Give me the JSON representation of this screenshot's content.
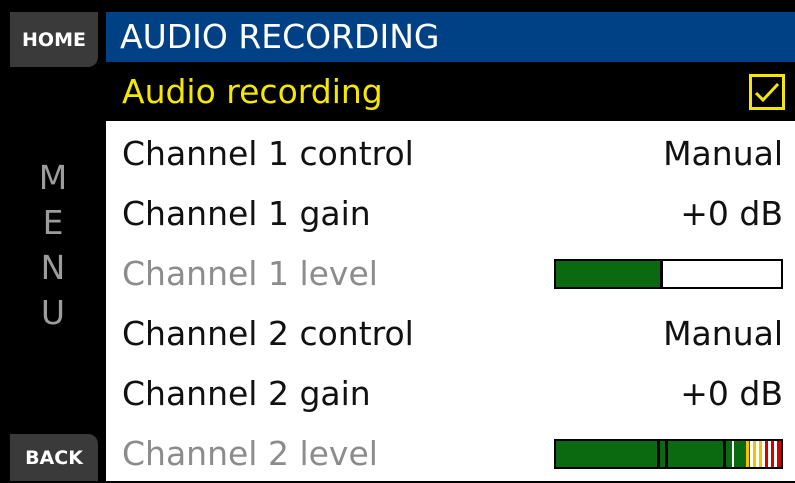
{
  "sidebar": {
    "home_label": "HOME",
    "back_label": "BACK",
    "menu_letters": [
      "M",
      "E",
      "N",
      "U"
    ]
  },
  "header": {
    "title": "AUDIO RECORDING"
  },
  "rows": [
    {
      "label": "Audio recording",
      "checked": true
    },
    {
      "label": "Channel 1 control",
      "value": "Manual"
    },
    {
      "label": "Channel 1 gain",
      "value": "+0 dB"
    },
    {
      "label": "Channel 1 level",
      "level": 0.46
    },
    {
      "label": "Channel 2 control",
      "value": "Manual"
    },
    {
      "label": "Channel 2 gain",
      "value": "+0 dB"
    },
    {
      "label": "Channel 2 level",
      "level": 1.0
    }
  ],
  "colors": {
    "header_bg": "#004186",
    "selected_text": "#f4e800",
    "meter_green": "#0b6a0f",
    "meter_yellow": "#f2c100",
    "meter_red": "#d40000"
  }
}
